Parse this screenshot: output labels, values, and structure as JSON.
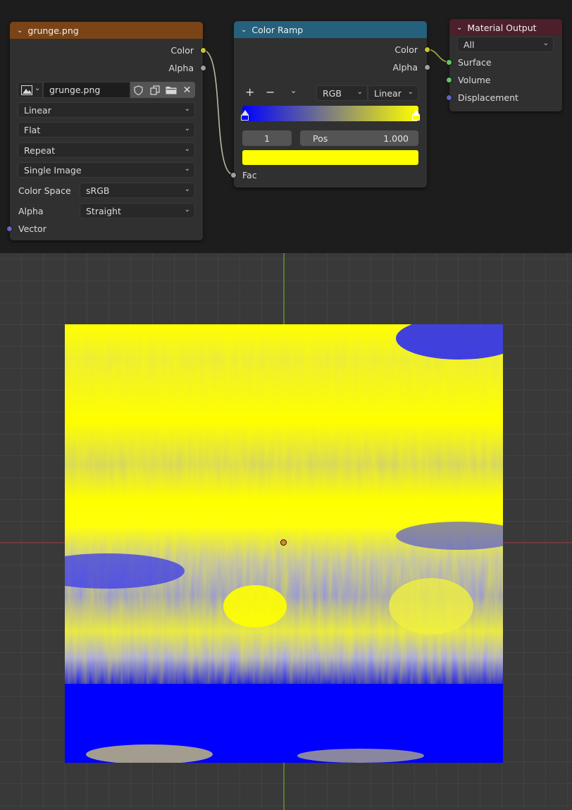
{
  "image_node": {
    "title": "grunge.png",
    "header_color": "#7a4417",
    "outputs": [
      "Color",
      "Alpha"
    ],
    "image_name": "grunge.png",
    "interpolation": "Linear",
    "projection": "Flat",
    "extension": "Repeat",
    "source": "Single Image",
    "color_space_label": "Color Space",
    "color_space": "sRGB",
    "alpha_label": "Alpha",
    "alpha_mode": "Straight",
    "vector_input": "Vector",
    "icons": [
      "image-browse-icon",
      "chevron-down-icon",
      "fake-user-shield-icon",
      "duplicate-icon",
      "folder-icon",
      "close-icon"
    ]
  },
  "color_ramp_node": {
    "title": "Color Ramp",
    "header_color": "#25607c",
    "outputs": [
      "Color",
      "Alpha"
    ],
    "add_label": "+",
    "remove_label": "−",
    "color_mode": "RGB",
    "interpolation": "Linear",
    "active_stop_index": "1",
    "pos_label": "Pos",
    "pos_value": "1.000",
    "stop_colors": [
      "#0000ff",
      "#ffff00"
    ],
    "stop_positions": [
      0.0,
      1.0
    ],
    "active_color": "#ffff00",
    "input": "Fac"
  },
  "material_output_node": {
    "title": "Material Output",
    "header_color": "#4d1f2b",
    "target": "All",
    "inputs": [
      "Surface",
      "Volume",
      "Displacement"
    ]
  },
  "viewport": {
    "background_color": "#393939",
    "x_axis_color": "#86363f",
    "y_axis_color": "#5b7a2e",
    "texture_colors": [
      "#0000ff",
      "#ffff00",
      "#ffffff"
    ],
    "origin_color": "#d68a2a"
  }
}
